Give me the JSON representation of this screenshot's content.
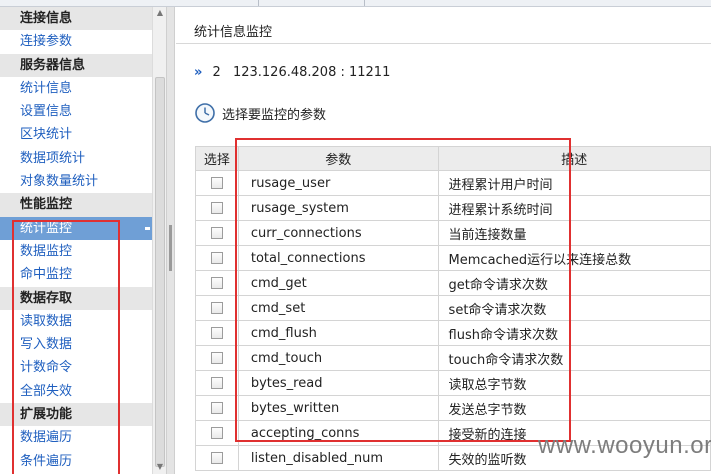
{
  "sidebar": {
    "items": [
      {
        "label": "连接信息",
        "kind": "head"
      },
      {
        "label": "连接参数",
        "kind": "link"
      },
      {
        "label": "服务器信息",
        "kind": "head"
      },
      {
        "label": "统计信息",
        "kind": "link"
      },
      {
        "label": "设置信息",
        "kind": "link"
      },
      {
        "label": "区块统计",
        "kind": "link"
      },
      {
        "label": "数据项统计",
        "kind": "link"
      },
      {
        "label": "对象数量统计",
        "kind": "link"
      },
      {
        "label": "性能监控",
        "kind": "head"
      },
      {
        "label": "统计监控",
        "kind": "active"
      },
      {
        "label": "数据监控",
        "kind": "link"
      },
      {
        "label": "命中监控",
        "kind": "link"
      },
      {
        "label": "数据存取",
        "kind": "head"
      },
      {
        "label": "读取数据",
        "kind": "link"
      },
      {
        "label": "写入数据",
        "kind": "link"
      },
      {
        "label": "计数命令",
        "kind": "link"
      },
      {
        "label": "全部失效",
        "kind": "link"
      },
      {
        "label": "扩展功能",
        "kind": "head"
      },
      {
        "label": "数据遍历",
        "kind": "link"
      },
      {
        "label": "条件遍历",
        "kind": "link"
      }
    ]
  },
  "main": {
    "title": "统计信息监控",
    "server": {
      "index": "2",
      "address": "123.126.48.208 : 11211"
    },
    "monitor_label": "选择要监控的参数"
  },
  "table": {
    "headers": {
      "select": "选择",
      "param": "参数",
      "desc": "描述"
    },
    "rows": [
      {
        "param": "rusage_user",
        "desc": "进程累计用户时间"
      },
      {
        "param": "rusage_system",
        "desc": "进程累计系统时间"
      },
      {
        "param": "curr_connections",
        "desc": "当前连接数量"
      },
      {
        "param": "total_connections",
        "desc": "Memcached运行以来连接总数"
      },
      {
        "param": "cmd_get",
        "desc": "get命令请求次数"
      },
      {
        "param": "cmd_set",
        "desc": "set命令请求次数"
      },
      {
        "param": "cmd_flush",
        "desc": "flush命令请求次数"
      },
      {
        "param": "cmd_touch",
        "desc": "touch命令请求次数"
      },
      {
        "param": "bytes_read",
        "desc": "读取总字节数"
      },
      {
        "param": "bytes_written",
        "desc": "发送总字节数"
      },
      {
        "param": "accepting_conns",
        "desc": "接受新的连接"
      },
      {
        "param": "listen_disabled_num",
        "desc": "失效的监听数"
      }
    ]
  },
  "watermark": "www.wooyun.org",
  "colors": {
    "link": "#1f5fbf",
    "active_bg": "#6f9fd6",
    "highlight": "#e03030"
  }
}
